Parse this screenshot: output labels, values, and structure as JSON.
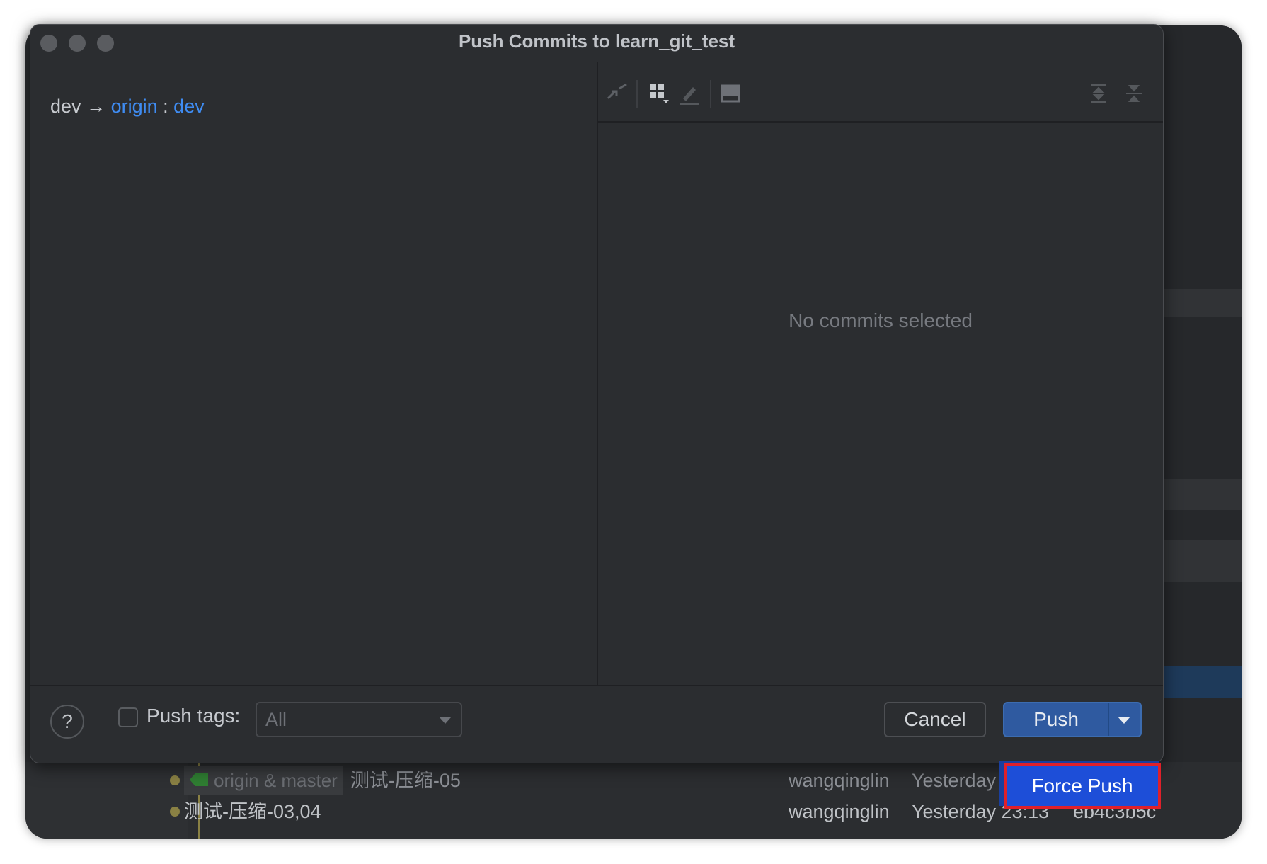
{
  "dialog": {
    "title": "Push Commits to learn_git_test",
    "branch": {
      "local": "dev",
      "arrow": "→",
      "remote": "origin",
      "colon": ":",
      "remote_branch": "dev"
    },
    "toolbar_icons": [
      "compare-icon",
      "group-by-icon",
      "edit-icon",
      "preview-icon",
      "expand-all-icon",
      "collapse-all-icon"
    ],
    "empty_message": "No commits selected",
    "footer": {
      "help": "?",
      "push_tags_label": "Push tags:",
      "push_tags_checked": false,
      "push_tags_value": "All",
      "cancel": "Cancel",
      "push": "Push"
    }
  },
  "popup": {
    "force_push": "Force Push"
  },
  "background_log": {
    "rows": [
      {
        "tag": "origin & master",
        "message": "测试-压缩-05",
        "author": "wangqinglin",
        "date": "Yesterday",
        "hash": ""
      },
      {
        "tag": "",
        "message": "测试-压缩-03,04",
        "author": "wangqinglin",
        "date": "Yesterday 23:13",
        "hash": "eb4c3b5c"
      }
    ]
  },
  "colors": {
    "accent": "#3f8cf2",
    "push_button": "#2f5aa0",
    "popup": "#1d4ed8",
    "highlight_border": "#e0202a"
  }
}
